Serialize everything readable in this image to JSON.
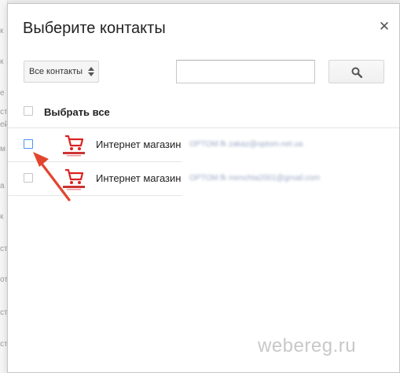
{
  "dialog": {
    "title": "Выберите контакты",
    "close_icon": "close-icon"
  },
  "toolbar": {
    "group_select": "Все контакты",
    "search_input_value": "",
    "search_icon": "search-icon"
  },
  "select_all": {
    "label": "Выбрать все",
    "checked": false
  },
  "contacts": [
    {
      "name": "Интернет магазин",
      "detail": "OPTOM.fk  zakaz@optom.net.ua",
      "checked": false,
      "logo": "shopping-cart-logo"
    },
    {
      "name": "Интернет магазин",
      "detail": "OPTOM.fk  menchta2001@gmail.com",
      "checked": false,
      "logo": "shopping-cart-logo"
    }
  ],
  "background": {
    "side_fragments": [
      "к",
      "к",
      "е",
      "ст",
      "ей",
      "м",
      "а",
      "к",
      "ст",
      "от",
      "ст",
      "ст"
    ]
  },
  "watermark": "webereg.ru",
  "colors": {
    "accent_checkbox": "#4d90fe",
    "annotation_arrow": "#e2452e"
  }
}
